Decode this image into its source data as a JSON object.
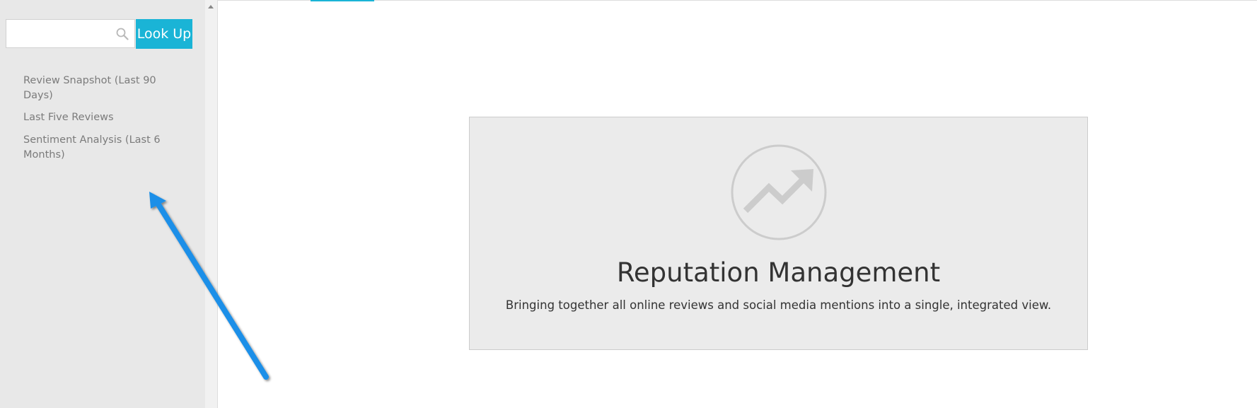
{
  "search": {
    "placeholder": "",
    "value": "",
    "button_label": "Look Up",
    "icon": "search-icon"
  },
  "sidebar": {
    "items": [
      {
        "label": "Review Snapshot (Last 90 Days)"
      },
      {
        "label": "Last Five Reviews"
      },
      {
        "label": "Sentiment Analysis (Last 6 Months)"
      }
    ]
  },
  "promo": {
    "icon": "trending-up-icon",
    "title": "Reputation Management",
    "subtitle": "Bringing together all online reviews and social media mentions into a single, integrated view."
  },
  "colors": {
    "accent": "#1ab4d6",
    "annotation_arrow": "#1a8fe8"
  }
}
